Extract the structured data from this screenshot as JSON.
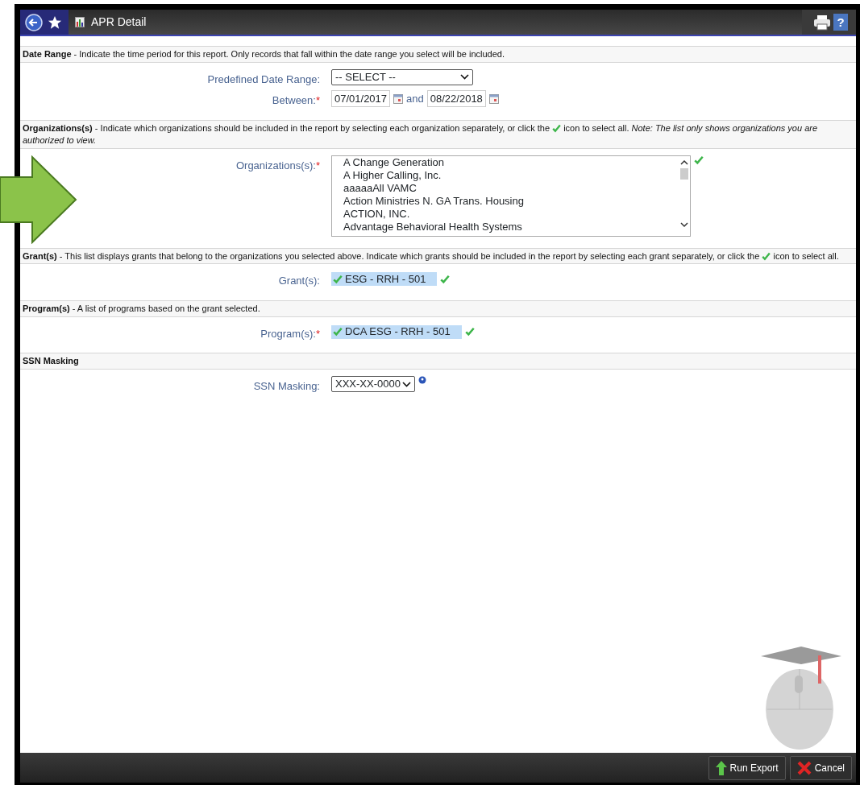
{
  "window": {
    "title": "APR Detail",
    "help_label": "?"
  },
  "sections": [
    {
      "heading": "Date Range",
      "description": [
        " - Indicate the time period for this report. Only records that fall within the date range you select will be included."
      ],
      "fields": [
        {
          "kind": "select",
          "label": "Predefined Date Range:",
          "value": "-- SELECT --"
        },
        {
          "kind": "date_range",
          "label": "Between:",
          "required_mark": "*",
          "from": "07/01/2017",
          "joiner": "and",
          "to": "08/22/2018"
        }
      ]
    },
    {
      "heading": "Organizations(s)",
      "description": [
        " - Indicate which organizations should be included in the report by selecting each organization separately, or click the",
        " icon to select all. *Note: The list only shows organizations you are authorized to view.*"
      ],
      "fields": [
        {
          "kind": "listbox",
          "label": "Organizations(s):",
          "required_mark": "*",
          "options": [
            "A Change Generation",
            "A Higher Calling, Inc.",
            "aaaaaAll VAMC",
            "Action Ministries N. GA Trans. Housing",
            "ACTION, INC.",
            "Advantage Behavioral Health Systems"
          ]
        }
      ]
    },
    {
      "heading": "Grant(s)",
      "description": [
        " - This list displays grants that belong to the organizations you selected above. Indicate which grants should be included in the report by selecting each grant separately, or click the",
        " icon to select all."
      ],
      "fields": [
        {
          "kind": "chip",
          "label": "Grant(s):",
          "value": "ESG - RRH - 501",
          "checked": true
        }
      ]
    },
    {
      "heading": "Program(s)",
      "description": [
        " - A list of programs based on the grant selected."
      ],
      "fields": [
        {
          "kind": "chip",
          "label": "Program(s):",
          "required_mark": "*",
          "value": "DCA ESG - RRH - 501",
          "checked": true
        }
      ]
    },
    {
      "heading": "SSN Masking",
      "fields": [
        {
          "kind": "select_help",
          "label": "SSN Masking:",
          "value": "XXX-XX-0000"
        }
      ]
    }
  ],
  "footer": {
    "buttons": [
      {
        "kind": "export",
        "label": "Run Export"
      },
      {
        "kind": "cancel",
        "label": "Cancel"
      }
    ]
  }
}
